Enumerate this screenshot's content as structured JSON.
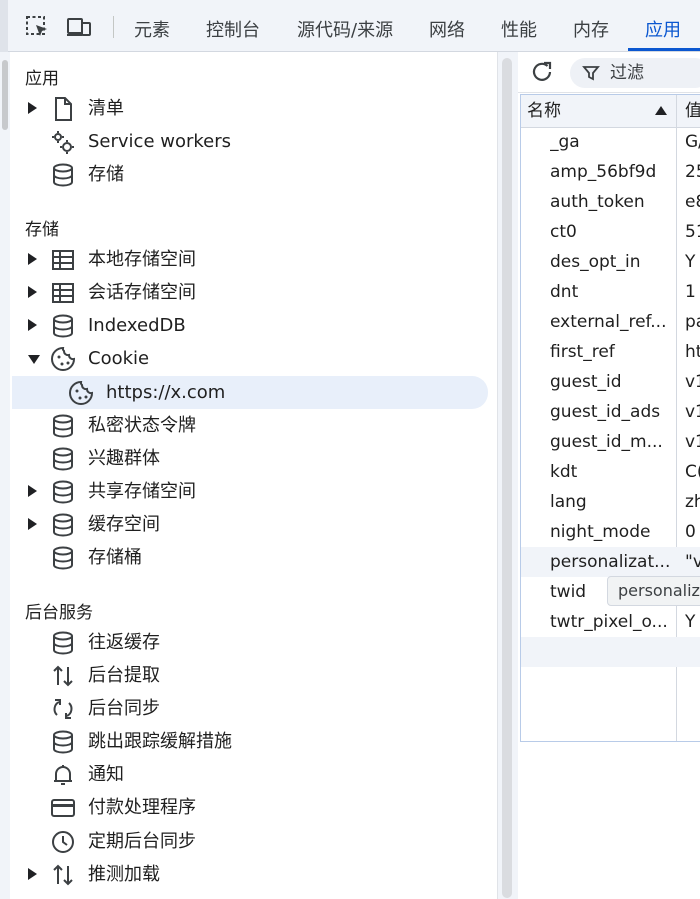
{
  "tabs": {
    "elements": "元素",
    "console": "控制台",
    "sources": "源代码/来源",
    "network": "网络",
    "performance": "性能",
    "memory": "内存",
    "application": "应用"
  },
  "sidebar": {
    "app_title": "应用",
    "app_items": [
      {
        "label": "清单",
        "icon": "document-icon",
        "expandable": true
      },
      {
        "label": "Service workers",
        "icon": "gears-icon",
        "expandable": false
      },
      {
        "label": "存储",
        "icon": "database-icon",
        "expandable": false
      }
    ],
    "storage_title": "存储",
    "storage_items": [
      {
        "label": "本地存储空间",
        "icon": "table-icon",
        "expandable": true
      },
      {
        "label": "会话存储空间",
        "icon": "table-icon",
        "expandable": true
      },
      {
        "label": "IndexedDB",
        "icon": "database-icon",
        "expandable": true
      },
      {
        "label": "Cookie",
        "icon": "cookie-icon",
        "expanded": true
      },
      {
        "label": "https://x.com",
        "icon": "cookie-icon",
        "selected": true
      },
      {
        "label": "私密状态令牌",
        "icon": "database-icon"
      },
      {
        "label": "兴趣群体",
        "icon": "database-icon"
      },
      {
        "label": "共享存储空间",
        "icon": "database-icon",
        "expandable": true
      },
      {
        "label": "缓存空间",
        "icon": "database-icon",
        "expandable": true
      },
      {
        "label": "存储桶",
        "icon": "database-icon"
      }
    ],
    "bg_title": "后台服务",
    "bg_items": [
      {
        "label": "往返缓存",
        "icon": "database-icon"
      },
      {
        "label": "后台提取",
        "icon": "up-down-arrows-icon"
      },
      {
        "label": "后台同步",
        "icon": "sync-icon"
      },
      {
        "label": "跳出跟踪缓解措施",
        "icon": "database-icon"
      },
      {
        "label": "通知",
        "icon": "bell-icon"
      },
      {
        "label": "付款处理程序",
        "icon": "credit-card-icon"
      },
      {
        "label": "定期后台同步",
        "icon": "clock-icon"
      },
      {
        "label": "推测加载",
        "icon": "up-down-arrows-icon",
        "expandable": true
      }
    ]
  },
  "toolbar": {
    "filter_placeholder": "过滤"
  },
  "cookie_table": {
    "col_name": "名称",
    "col_value": "值",
    "rows": [
      {
        "name": "_ga",
        "value": "G/"
      },
      {
        "name": "amp_56bf9d",
        "value": "25"
      },
      {
        "name": "auth_token",
        "value": "e8"
      },
      {
        "name": "ct0",
        "value": "51"
      },
      {
        "name": "des_opt_in",
        "value": "Y"
      },
      {
        "name": "dnt",
        "value": "1"
      },
      {
        "name": "external_ref...",
        "value": "pa"
      },
      {
        "name": "first_ref",
        "value": "ht"
      },
      {
        "name": "guest_id",
        "value": "v1"
      },
      {
        "name": "guest_id_ads",
        "value": "v1"
      },
      {
        "name": "guest_id_m...",
        "value": "v1"
      },
      {
        "name": "kdt",
        "value": "C("
      },
      {
        "name": "lang",
        "value": "zh"
      },
      {
        "name": "night_mode",
        "value": "0"
      },
      {
        "name": "personalizat...",
        "value": "\"v"
      },
      {
        "name": "twid",
        "value": ""
      },
      {
        "name": "twtr_pixel_o...",
        "value": "Y"
      }
    ],
    "tooltip": "personaliza"
  },
  "colors": {
    "accent": "#0b57d0",
    "selected_bg": "#e8effa",
    "panel_bg": "#f1f4f9"
  }
}
